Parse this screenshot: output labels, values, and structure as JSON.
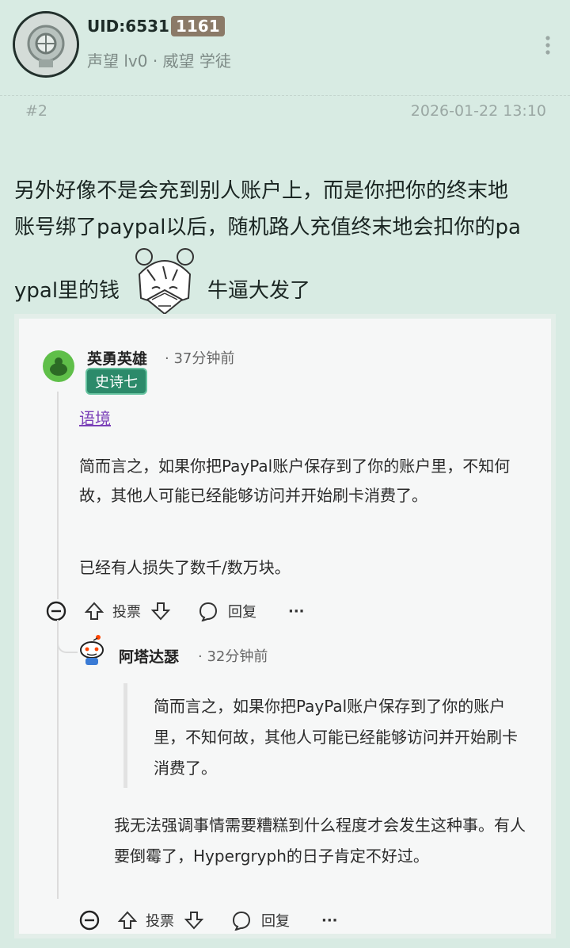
{
  "header": {
    "uid_label": "UID:6531",
    "uid_tag": "1161",
    "reputation": "声望 lv0 · 威望 学徒",
    "floor": "#2",
    "timestamp": "2026-01-22 13:10"
  },
  "post": {
    "line1": "另外好像不是会充到别人账户上，而是你把你的终末地",
    "line2": "账号绑了paypal以后，随机路人充值终末地会扣你的pa",
    "line3_a": "ypal里的钱",
    "line3_b": "牛逼大发了"
  },
  "embed": {
    "comment1": {
      "user": "英勇英雄",
      "time": "· 37分钟前",
      "flair": "史诗七",
      "link": "语境",
      "body": "简而言之，如果你把PayPal账户保存到了你的账户里，不知何故，其他人可能已经能够访问并开始刷卡消费了。",
      "extra": "已经有人损失了数千/数万块。",
      "vote_label": "投票",
      "reply_label": "回复",
      "more": "···"
    },
    "comment2": {
      "user": "阿塔达瑟",
      "time": "· 32分钟前",
      "quote": "简而言之，如果你把PayPal账户保存到了你的账户里，不知何故，其他人可能已经能够访问并开始刷卡消费了。",
      "body": "我无法强调事情需要糟糕到什么程度才会发生这种事。有人要倒霉了，Hypergryph的日子肯定不好过。",
      "vote_label": "投票",
      "reply_label": "回复",
      "more": "···"
    }
  },
  "icons": {
    "more": "more-vertical-icon",
    "collapse": "collapse-circle-icon",
    "upvote": "upvote-arrow-icon",
    "downvote": "downvote-arrow-icon",
    "reply": "comment-bubble-icon"
  }
}
